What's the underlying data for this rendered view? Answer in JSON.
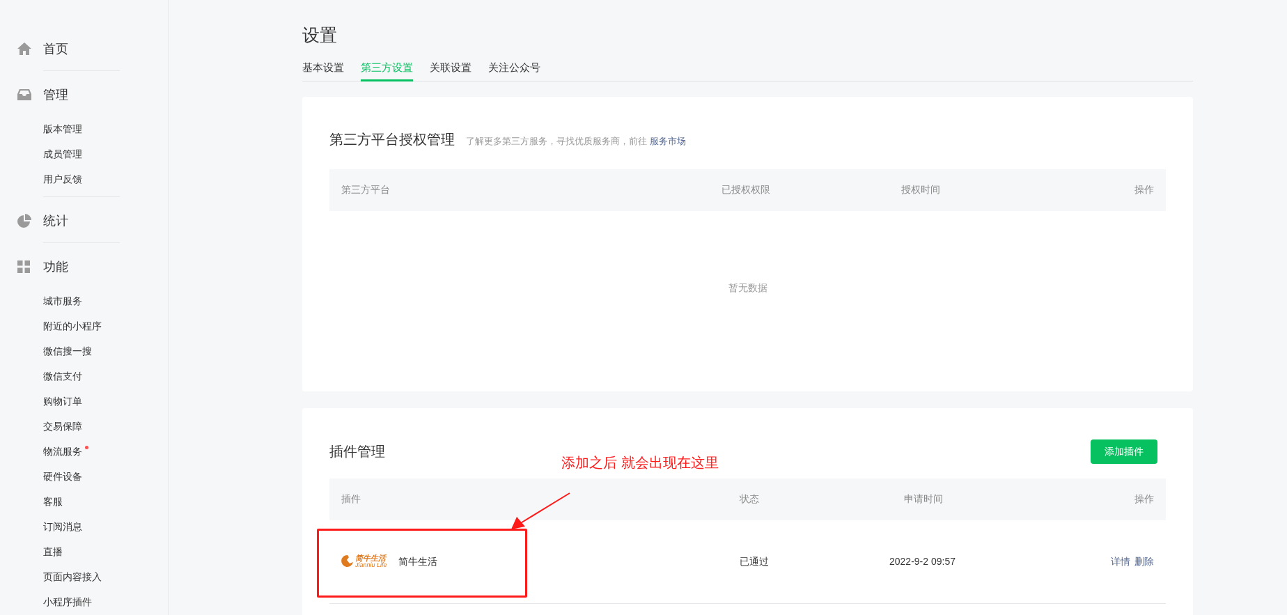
{
  "sidebar": {
    "sections": [
      {
        "label": "首页"
      },
      {
        "label": "管理",
        "items": [
          {
            "label": "版本管理",
            "dot": false
          },
          {
            "label": "成员管理",
            "dot": false
          },
          {
            "label": "用户反馈",
            "dot": false
          }
        ]
      },
      {
        "label": "统计"
      },
      {
        "label": "功能",
        "items": [
          {
            "label": "城市服务",
            "dot": false
          },
          {
            "label": "附近的小程序",
            "dot": false
          },
          {
            "label": "微信搜一搜",
            "dot": false
          },
          {
            "label": "微信支付",
            "dot": false
          },
          {
            "label": "购物订单",
            "dot": false
          },
          {
            "label": "交易保障",
            "dot": false
          },
          {
            "label": "物流服务",
            "dot": true
          },
          {
            "label": "硬件设备",
            "dot": false
          },
          {
            "label": "客服",
            "dot": false
          },
          {
            "label": "订阅消息",
            "dot": false
          },
          {
            "label": "直播",
            "dot": false
          },
          {
            "label": "页面内容接入",
            "dot": false
          },
          {
            "label": "小程序插件",
            "dot": false
          }
        ]
      }
    ]
  },
  "page": {
    "title": "设置",
    "tabs": [
      {
        "label": "基本设置",
        "selected": false
      },
      {
        "label": "第三方设置",
        "selected": true
      },
      {
        "label": "关联设置",
        "selected": false
      },
      {
        "label": "关注公众号",
        "selected": false
      }
    ]
  },
  "auth_card": {
    "title": "第三方平台授权管理",
    "hint": "了解更多第三方服务，寻找优质服务商，前往",
    "hint_link": "服务市场",
    "columns": [
      "第三方平台",
      "已授权权限",
      "授权时间",
      "操作"
    ],
    "empty_text": "暂无数据"
  },
  "plugin_card": {
    "title": "插件管理",
    "add_button": "添加插件",
    "columns": [
      "插件",
      "状态",
      "申请时间",
      "操作"
    ],
    "rows": [
      {
        "logo_text": "简牛生活",
        "logo_subtext": "Jianniu Life",
        "name": "简牛生活",
        "status": "已通过",
        "time": "2022-9-2 09:57",
        "actions": [
          "详情",
          "删除"
        ]
      }
    ]
  },
  "annotation": {
    "text": "添加之后 就会出现在这里"
  }
}
